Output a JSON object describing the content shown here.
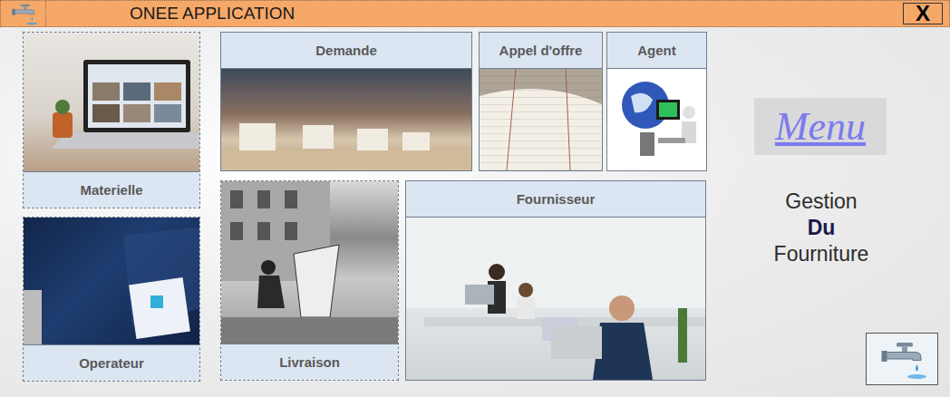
{
  "window": {
    "title": "ONEE APPLICATION",
    "close": "X"
  },
  "tiles": [
    {
      "label": "Materielle"
    },
    {
      "label": "Operateur"
    },
    {
      "label": "Demande"
    },
    {
      "label": "Appel d'offre"
    },
    {
      "label": "Agent"
    },
    {
      "label": "Livraison"
    },
    {
      "label": "Fournisseur"
    }
  ],
  "menu": {
    "title": "Menu",
    "subtitle": [
      "Gestion",
      "Du",
      "Fourniture"
    ]
  }
}
